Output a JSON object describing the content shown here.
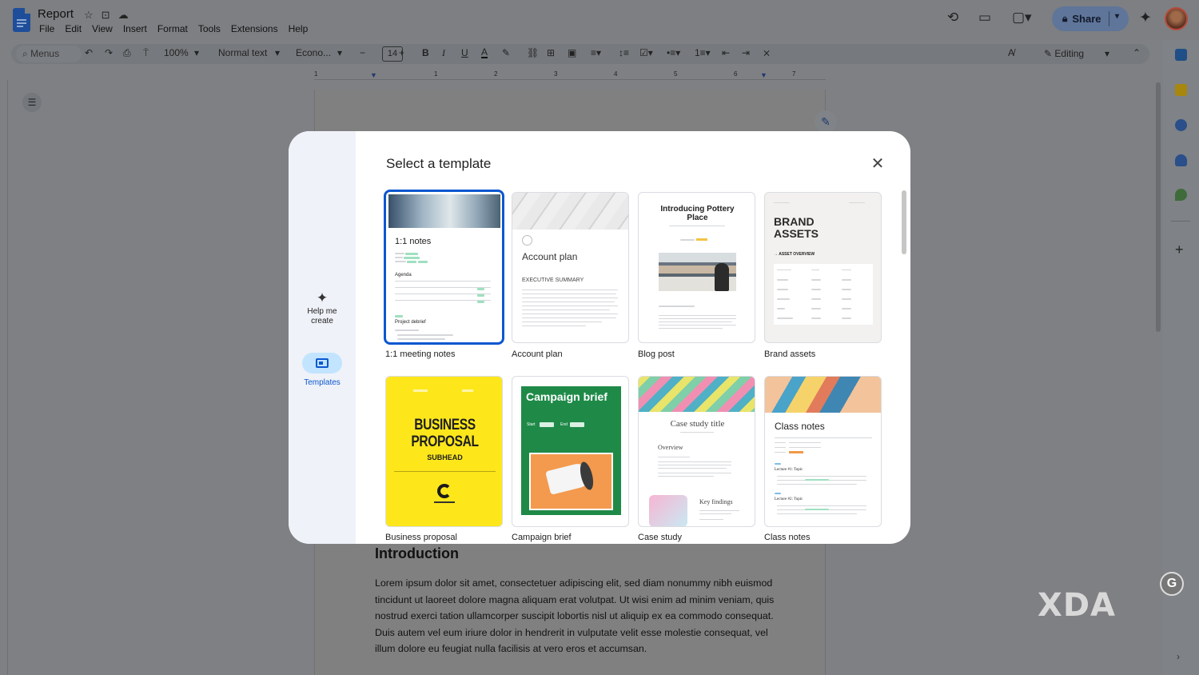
{
  "app": {
    "doc_title": "Report",
    "menu": [
      "File",
      "Edit",
      "View",
      "Insert",
      "Format",
      "Tools",
      "Extensions",
      "Help"
    ],
    "share_label": "Share"
  },
  "toolbar": {
    "menus_label": "Menus",
    "zoom": "100%",
    "style": "Normal text",
    "font": "Econo...",
    "font_size": "14",
    "mode": "Editing"
  },
  "ruler_numbers": [
    "1",
    "1",
    "2",
    "3",
    "4",
    "5",
    "6",
    "7"
  ],
  "document": {
    "heading": "Introduction",
    "paragraph": "Lorem ipsum dolor sit amet, consectetuer adipiscing elit, sed diam nonummy nibh euismod tincidunt ut laoreet dolore magna aliquam erat volutpat. Ut wisi enim ad minim veniam, quis nostrud exerci tation ullamcorper suscipit lobortis nisl ut aliquip ex ea commodo consequat. Duis autem vel eum iriure dolor in hendrerit in vulputate velit esse molestie consequat, vel illum dolore eu feugiat nulla facilisis at vero eros et accumsan."
  },
  "modal": {
    "title": "Select a template",
    "rail": {
      "help_label": "Help me create",
      "templates_label": "Templates"
    },
    "templates": [
      {
        "label": "1:1 meeting notes",
        "thumb_title": "1:1 notes",
        "thumb_sub1": "Agenda",
        "thumb_sub2": "Project debrief"
      },
      {
        "label": "Account plan",
        "thumb_title": "Account plan",
        "thumb_sub1": "EXECUTIVE SUMMARY"
      },
      {
        "label": "Blog post",
        "thumb_title": "Introducing Pottery Place"
      },
      {
        "label": "Brand assets",
        "thumb_title": "BRAND ASSETS",
        "thumb_sub1": "→ ASSET OVERVIEW"
      },
      {
        "label": "Business proposal",
        "thumb_title": "BUSINESS PROPOSAL",
        "thumb_sub1": "SUBHEAD"
      },
      {
        "label": "Campaign brief",
        "thumb_title": "Campaign brief",
        "thumb_sub1": "Start",
        "thumb_sub2": "End"
      },
      {
        "label": "Case study",
        "thumb_title": "Case study title",
        "thumb_sub1": "Overview",
        "thumb_sub2": "Key findings"
      },
      {
        "label": "Class notes",
        "thumb_title": "Class notes",
        "thumb_sub1": "Lecture #1: Topic",
        "thumb_sub2": "Lecture #2: Topic"
      }
    ]
  },
  "watermark": "XDA",
  "colors": {
    "accent": "#0b57d0",
    "rail_bg": "#eff2f8",
    "selected_pill": "#c2e4ff",
    "proposal_yellow": "#fde71b",
    "campaign_green": "#1f8a48",
    "campaign_orange": "#f39a4e"
  }
}
